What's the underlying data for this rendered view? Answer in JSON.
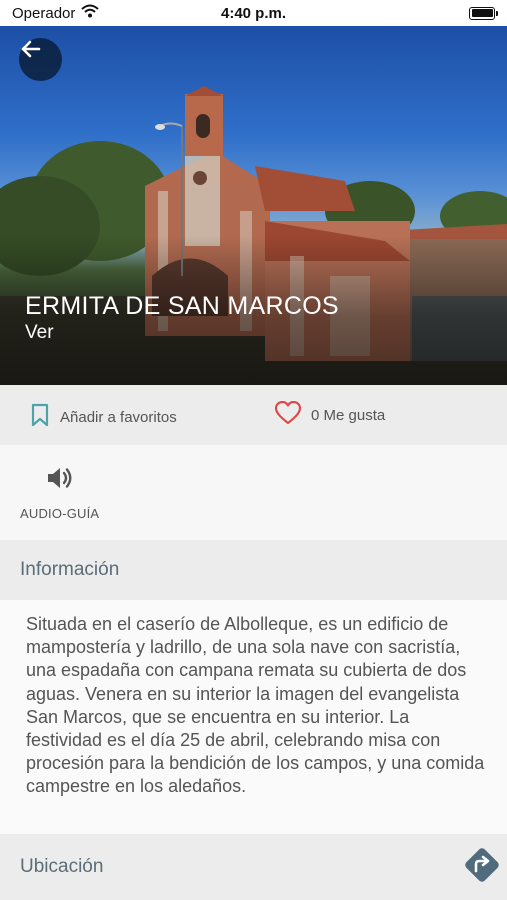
{
  "status_bar": {
    "carrier": "Operador",
    "time": "4:40 p.m."
  },
  "hero": {
    "title": "ERMITA DE SAN MARCOS",
    "subtitle": "Ver"
  },
  "actions": {
    "favorite_label": "Añadir a favoritos",
    "like_label": "0 Me gusta"
  },
  "audio_guide": {
    "label": "AUDIO-GUÍA"
  },
  "info": {
    "header": "Información",
    "body": "Situada en el caserío de Albolleque, es un edificio de mampostería y ladrillo, de una sola nave con sacristía, una espadaña con campana remata su cubierta de dos aguas. Venera en su interior la imagen del evangelista San Marcos, que se encuentra en su interior. La festividad es el día 25 de abril, celebrando misa con procesión para la bendición de los campos, y una comida campestre en los aledaños."
  },
  "location": {
    "header": "Ubicación"
  },
  "colors": {
    "accent_teal": "#4da3a8",
    "like_red": "#e04848",
    "nav_dark": "#4f6b7c"
  },
  "icons": {
    "back": "arrow-left-icon",
    "favorite": "bookmark-icon",
    "like": "heart-icon",
    "audio": "speaker-icon",
    "directions": "directions-icon"
  }
}
